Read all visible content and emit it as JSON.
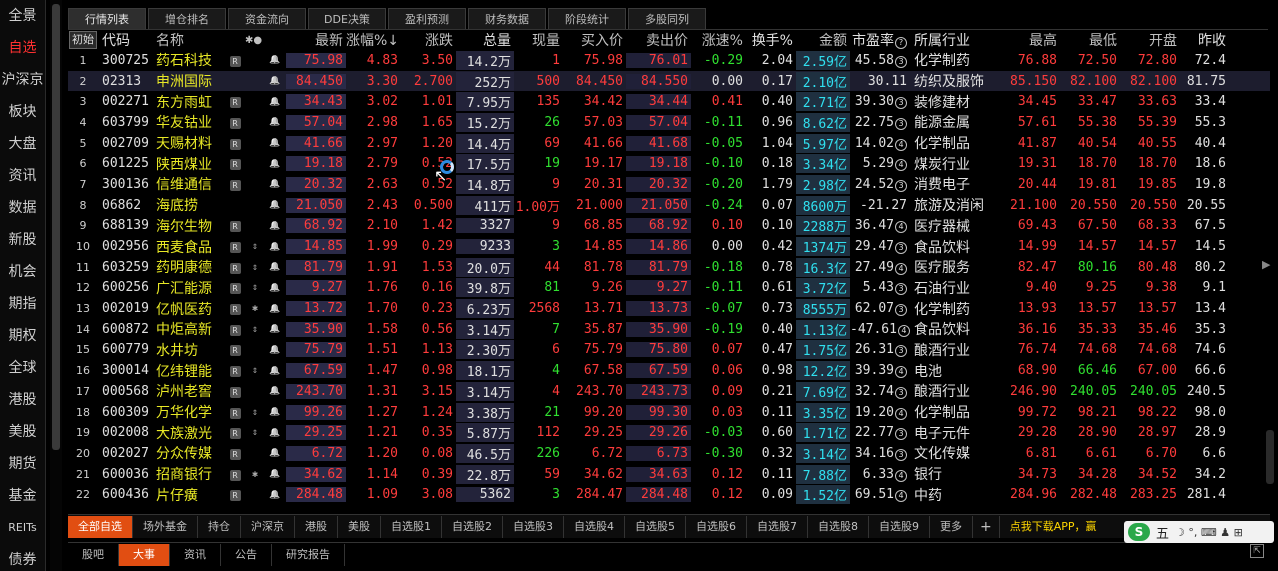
{
  "sidebar": {
    "items": [
      {
        "label": "全景",
        "active": false
      },
      {
        "label": "自选",
        "active": true
      },
      {
        "label": "沪深京",
        "active": false
      },
      {
        "label": "板块",
        "active": false
      },
      {
        "label": "大盘",
        "active": false
      },
      {
        "label": "资讯",
        "active": false
      },
      {
        "label": "数据",
        "active": false
      },
      {
        "label": "新股",
        "active": false
      },
      {
        "label": "机会",
        "active": false
      },
      {
        "label": "期指",
        "active": false
      },
      {
        "label": "期权",
        "active": false
      },
      {
        "label": "全球",
        "active": false
      },
      {
        "label": "港股",
        "active": false
      },
      {
        "label": "美股",
        "active": false
      },
      {
        "label": "期货",
        "active": false
      },
      {
        "label": "基金",
        "active": false
      },
      {
        "label": "REITs",
        "active": false
      },
      {
        "label": "债券",
        "active": false
      }
    ]
  },
  "top_tabs": [
    "行情列表",
    "增仓排名",
    "资金流向",
    "DDE决策",
    "盈利预测",
    "财务数据",
    "阶段统计",
    "多股同列"
  ],
  "header": {
    "init": "初始",
    "code": "代码",
    "name": "名称",
    "mark": "✱●",
    "price": "最新",
    "pct": "涨幅%↓",
    "chg": "涨跌",
    "vol": "总量",
    "cur": "现量",
    "bid": "买入价",
    "ask": "卖出价",
    "spd": "涨速%",
    "turn": "换手%",
    "amt": "金额",
    "pe": "市盈率",
    "pe_icon": "?",
    "ind": "所属行业",
    "high": "最高",
    "low": "最低",
    "open": "开盘",
    "prev": "昨收"
  },
  "rows": [
    {
      "idx": "1",
      "code": "300725",
      "name": "药石科技",
      "r": "R",
      "mark": "",
      "price": "75.98",
      "pct": "4.83",
      "chg": "3.50",
      "vol": "14.2万",
      "cur": "1",
      "bid": "75.98",
      "ask": "76.01",
      "spd": "-0.29",
      "turn": "2.04",
      "amt": "2.59亿",
      "pe": "45.58",
      "pe_q": "3",
      "ind": "化学制药",
      "high": "76.88",
      "low": "72.50",
      "open": "72.80",
      "prev": "72.4"
    },
    {
      "idx": "2",
      "code": "02313",
      "name": "申洲国际",
      "r": "",
      "mark": "",
      "price": "84.450",
      "pct": "3.30",
      "chg": "2.700",
      "vol": "252万",
      "cur": "500",
      "bid": "84.450",
      "ask": "84.550",
      "spd": "0.00",
      "turn": "0.17",
      "amt": "2.10亿",
      "pe": "30.11",
      "pe_q": "",
      "ind": "纺织及服饰",
      "high": "85.150",
      "low": "82.100",
      "open": "82.100",
      "prev": "81.75"
    },
    {
      "idx": "3",
      "code": "002271",
      "name": "东方雨虹",
      "r": "R",
      "mark": "",
      "price": "34.43",
      "pct": "3.02",
      "chg": "1.01",
      "vol": "7.95万",
      "cur": "135",
      "bid": "34.42",
      "ask": "34.44",
      "spd": "0.41",
      "turn": "0.40",
      "amt": "2.71亿",
      "pe": "39.30",
      "pe_q": "3",
      "ind": "装修建材",
      "high": "34.45",
      "low": "33.47",
      "open": "33.63",
      "prev": "33.4"
    },
    {
      "idx": "4",
      "code": "603799",
      "name": "华友钴业",
      "r": "R",
      "mark": "",
      "price": "57.04",
      "pct": "2.98",
      "chg": "1.65",
      "vol": "15.2万",
      "cur": "26",
      "bid": "57.03",
      "ask": "57.04",
      "spd": "-0.11",
      "turn": "0.96",
      "amt": "8.62亿",
      "pe": "22.75",
      "pe_q": "3",
      "ind": "能源金属",
      "high": "57.61",
      "low": "55.38",
      "open": "55.39",
      "prev": "55.3"
    },
    {
      "idx": "5",
      "code": "002709",
      "name": "天赐材料",
      "r": "R",
      "mark": "",
      "price": "41.66",
      "pct": "2.97",
      "chg": "1.20",
      "vol": "14.4万",
      "cur": "69",
      "bid": "41.66",
      "ask": "41.68",
      "spd": "-0.05",
      "turn": "1.04",
      "amt": "5.97亿",
      "pe": "14.02",
      "pe_q": "4",
      "ind": "化学制品",
      "high": "41.87",
      "low": "40.54",
      "open": "40.55",
      "prev": "40.4"
    },
    {
      "idx": "6",
      "code": "601225",
      "name": "陕西煤业",
      "r": "R",
      "mark": "",
      "price": "19.18",
      "pct": "2.79",
      "chg": "0.52",
      "vol": "17.5万",
      "cur": "19",
      "bid": "19.17",
      "ask": "19.18",
      "spd": "-0.10",
      "turn": "0.18",
      "amt": "3.34亿",
      "pe": "5.29",
      "pe_q": "4",
      "ind": "煤炭行业",
      "high": "19.31",
      "low": "18.70",
      "open": "18.70",
      "prev": "18.6"
    },
    {
      "idx": "7",
      "code": "300136",
      "name": "信维通信",
      "r": "R",
      "mark": "",
      "price": "20.32",
      "pct": "2.63",
      "chg": "0.52",
      "vol": "14.8万",
      "cur": "9",
      "bid": "20.31",
      "ask": "20.32",
      "spd": "-0.20",
      "turn": "1.79",
      "amt": "2.98亿",
      "pe": "24.52",
      "pe_q": "3",
      "ind": "消费电子",
      "high": "20.44",
      "low": "19.81",
      "open": "19.85",
      "prev": "19.8"
    },
    {
      "idx": "8",
      "code": "06862",
      "name": "海底捞",
      "r": "",
      "mark": "",
      "price": "21.050",
      "pct": "2.43",
      "chg": "0.500",
      "vol": "411万",
      "cur": "1.00万",
      "bid": "21.000",
      "ask": "21.050",
      "spd": "-0.24",
      "turn": "0.07",
      "amt": "8600万",
      "pe": "-21.27",
      "pe_q": "",
      "ind": "旅游及消闲",
      "high": "21.100",
      "low": "20.550",
      "open": "20.550",
      "prev": "20.55"
    },
    {
      "idx": "9",
      "code": "688139",
      "name": "海尔生物",
      "r": "R",
      "mark": "",
      "price": "68.92",
      "pct": "2.10",
      "chg": "1.42",
      "vol": "3327",
      "cur": "9",
      "bid": "68.85",
      "ask": "68.92",
      "spd": "0.10",
      "turn": "0.10",
      "amt": "2288万",
      "pe": "36.47",
      "pe_q": "4",
      "ind": "医疗器械",
      "high": "69.43",
      "low": "67.50",
      "open": "68.33",
      "prev": "67.5"
    },
    {
      "idx": "10",
      "code": "002956",
      "name": "西麦食品",
      "r": "R",
      "mark": "⇕",
      "price": "14.85",
      "pct": "1.99",
      "chg": "0.29",
      "vol": "9233",
      "cur": "3",
      "bid": "14.85",
      "ask": "14.86",
      "spd": "0.00",
      "turn": "0.42",
      "amt": "1374万",
      "pe": "29.47",
      "pe_q": "3",
      "ind": "食品饮料",
      "high": "14.99",
      "low": "14.57",
      "open": "14.57",
      "prev": "14.5"
    },
    {
      "idx": "11",
      "code": "603259",
      "name": "药明康德",
      "r": "R",
      "mark": "⇕",
      "price": "81.79",
      "pct": "1.91",
      "chg": "1.53",
      "vol": "20.0万",
      "cur": "44",
      "bid": "81.78",
      "ask": "81.79",
      "spd": "-0.18",
      "turn": "0.78",
      "amt": "16.3亿",
      "pe": "27.49",
      "pe_q": "4",
      "ind": "医疗服务",
      "high": "82.47",
      "low": "80.16",
      "open": "80.48",
      "prev": "80.2"
    },
    {
      "idx": "12",
      "code": "600256",
      "name": "广汇能源",
      "r": "R",
      "mark": "⇕",
      "price": "9.27",
      "pct": "1.76",
      "chg": "0.16",
      "vol": "39.8万",
      "cur": "81",
      "bid": "9.26",
      "ask": "9.27",
      "spd": "-0.11",
      "turn": "0.61",
      "amt": "3.72亿",
      "pe": "5.43",
      "pe_q": "3",
      "ind": "石油行业",
      "high": "9.40",
      "low": "9.25",
      "open": "9.38",
      "prev": "9.1"
    },
    {
      "idx": "13",
      "code": "002019",
      "name": "亿帆医药",
      "r": "R",
      "mark": "✱",
      "price": "13.72",
      "pct": "1.70",
      "chg": "0.23",
      "vol": "6.23万",
      "cur": "2568",
      "bid": "13.71",
      "ask": "13.73",
      "spd": "-0.07",
      "turn": "0.73",
      "amt": "8555万",
      "pe": "62.07",
      "pe_q": "3",
      "ind": "化学制药",
      "high": "13.93",
      "low": "13.57",
      "open": "13.57",
      "prev": "13.4"
    },
    {
      "idx": "14",
      "code": "600872",
      "name": "中炬高新",
      "r": "R",
      "mark": "⇕",
      "price": "35.90",
      "pct": "1.58",
      "chg": "0.56",
      "vol": "3.14万",
      "cur": "7",
      "bid": "35.87",
      "ask": "35.90",
      "spd": "-0.19",
      "turn": "0.40",
      "amt": "1.13亿",
      "pe": "-47.61",
      "pe_q": "4",
      "ind": "食品饮料",
      "high": "36.16",
      "low": "35.33",
      "open": "35.46",
      "prev": "35.3"
    },
    {
      "idx": "15",
      "code": "600779",
      "name": "水井坊",
      "r": "R",
      "mark": "",
      "price": "75.79",
      "pct": "1.51",
      "chg": "1.13",
      "vol": "2.30万",
      "cur": "6",
      "bid": "75.79",
      "ask": "75.80",
      "spd": "0.07",
      "turn": "0.47",
      "amt": "1.75亿",
      "pe": "26.31",
      "pe_q": "3",
      "ind": "酿酒行业",
      "high": "76.74",
      "low": "74.68",
      "open": "74.68",
      "prev": "74.6"
    },
    {
      "idx": "16",
      "code": "300014",
      "name": "亿纬锂能",
      "r": "R",
      "mark": "⇕",
      "price": "67.59",
      "pct": "1.47",
      "chg": "0.98",
      "vol": "18.1万",
      "cur": "4",
      "bid": "67.58",
      "ask": "67.59",
      "spd": "0.06",
      "turn": "0.98",
      "amt": "12.2亿",
      "pe": "39.39",
      "pe_q": "4",
      "ind": "电池",
      "high": "68.90",
      "low": "66.46",
      "open": "67.00",
      "prev": "66.6"
    },
    {
      "idx": "17",
      "code": "000568",
      "name": "泸州老窖",
      "r": "R",
      "mark": "",
      "price": "243.70",
      "pct": "1.31",
      "chg": "3.15",
      "vol": "3.14万",
      "cur": "4",
      "bid": "243.70",
      "ask": "243.73",
      "spd": "0.09",
      "turn": "0.21",
      "amt": "7.69亿",
      "pe": "32.74",
      "pe_q": "3",
      "ind": "酿酒行业",
      "high": "246.90",
      "low": "240.05",
      "open": "240.05",
      "prev": "240.5"
    },
    {
      "idx": "18",
      "code": "600309",
      "name": "万华化学",
      "r": "R",
      "mark": "⇕",
      "price": "99.26",
      "pct": "1.27",
      "chg": "1.24",
      "vol": "3.38万",
      "cur": "21",
      "bid": "99.20",
      "ask": "99.30",
      "spd": "0.03",
      "turn": "0.11",
      "amt": "3.35亿",
      "pe": "19.20",
      "pe_q": "4",
      "ind": "化学制品",
      "high": "99.72",
      "low": "98.21",
      "open": "98.22",
      "prev": "98.0"
    },
    {
      "idx": "19",
      "code": "002008",
      "name": "大族激光",
      "r": "R",
      "mark": "⇕",
      "price": "29.25",
      "pct": "1.21",
      "chg": "0.35",
      "vol": "5.87万",
      "cur": "112",
      "bid": "29.25",
      "ask": "29.26",
      "spd": "-0.03",
      "turn": "0.60",
      "amt": "1.71亿",
      "pe": "22.77",
      "pe_q": "3",
      "ind": "电子元件",
      "high": "29.28",
      "low": "28.90",
      "open": "28.97",
      "prev": "28.9"
    },
    {
      "idx": "20",
      "code": "002027",
      "name": "分众传媒",
      "r": "R",
      "mark": "",
      "price": "6.72",
      "pct": "1.20",
      "chg": "0.08",
      "vol": "46.5万",
      "cur": "226",
      "bid": "6.72",
      "ask": "6.73",
      "spd": "-0.30",
      "turn": "0.32",
      "amt": "3.14亿",
      "pe": "34.16",
      "pe_q": "3",
      "ind": "文化传媒",
      "high": "6.81",
      "low": "6.61",
      "open": "6.70",
      "prev": "6.6"
    },
    {
      "idx": "21",
      "code": "600036",
      "name": "招商银行",
      "r": "R",
      "mark": "✱",
      "price": "34.62",
      "pct": "1.14",
      "chg": "0.39",
      "vol": "22.8万",
      "cur": "59",
      "bid": "34.62",
      "ask": "34.63",
      "spd": "0.12",
      "turn": "0.11",
      "amt": "7.88亿",
      "pe": "6.33",
      "pe_q": "4",
      "ind": "银行",
      "high": "34.73",
      "low": "34.28",
      "open": "34.52",
      "prev": "34.2"
    },
    {
      "idx": "22",
      "code": "600436",
      "name": "片仔癀",
      "r": "R",
      "mark": "",
      "price": "284.48",
      "pct": "1.09",
      "chg": "3.08",
      "vol": "5362",
      "cur": "3",
      "bid": "284.47",
      "ask": "284.48",
      "spd": "0.12",
      "turn": "0.09",
      "amt": "1.52亿",
      "pe": "69.51",
      "pe_q": "4",
      "ind": "中药",
      "high": "284.96",
      "low": "282.48",
      "open": "283.25",
      "prev": "281.4"
    }
  ],
  "bottom_tabs": [
    "全部自选",
    "场外基金",
    "持仓",
    "沪深京",
    "港股",
    "美股",
    "自选股1",
    "自选股2",
    "自选股3",
    "自选股4",
    "自选股5",
    "自选股6",
    "自选股7",
    "自选股8",
    "自选股9",
    "更多"
  ],
  "bottom_plus": "+",
  "promo": "点我下载APP，赢",
  "news_tabs": [
    "股吧",
    "大事",
    "资讯",
    "公告",
    "研究报告"
  ],
  "ime": {
    "logo": "S",
    "label": "五",
    "icons": "☽ °, ⌨ ♟ ⊞"
  },
  "colors": {
    "up": "#ff3c3c",
    "down": "#30e030",
    "accent": "#e14e12",
    "name": "#e8e826",
    "amount": "#30e0f0"
  }
}
